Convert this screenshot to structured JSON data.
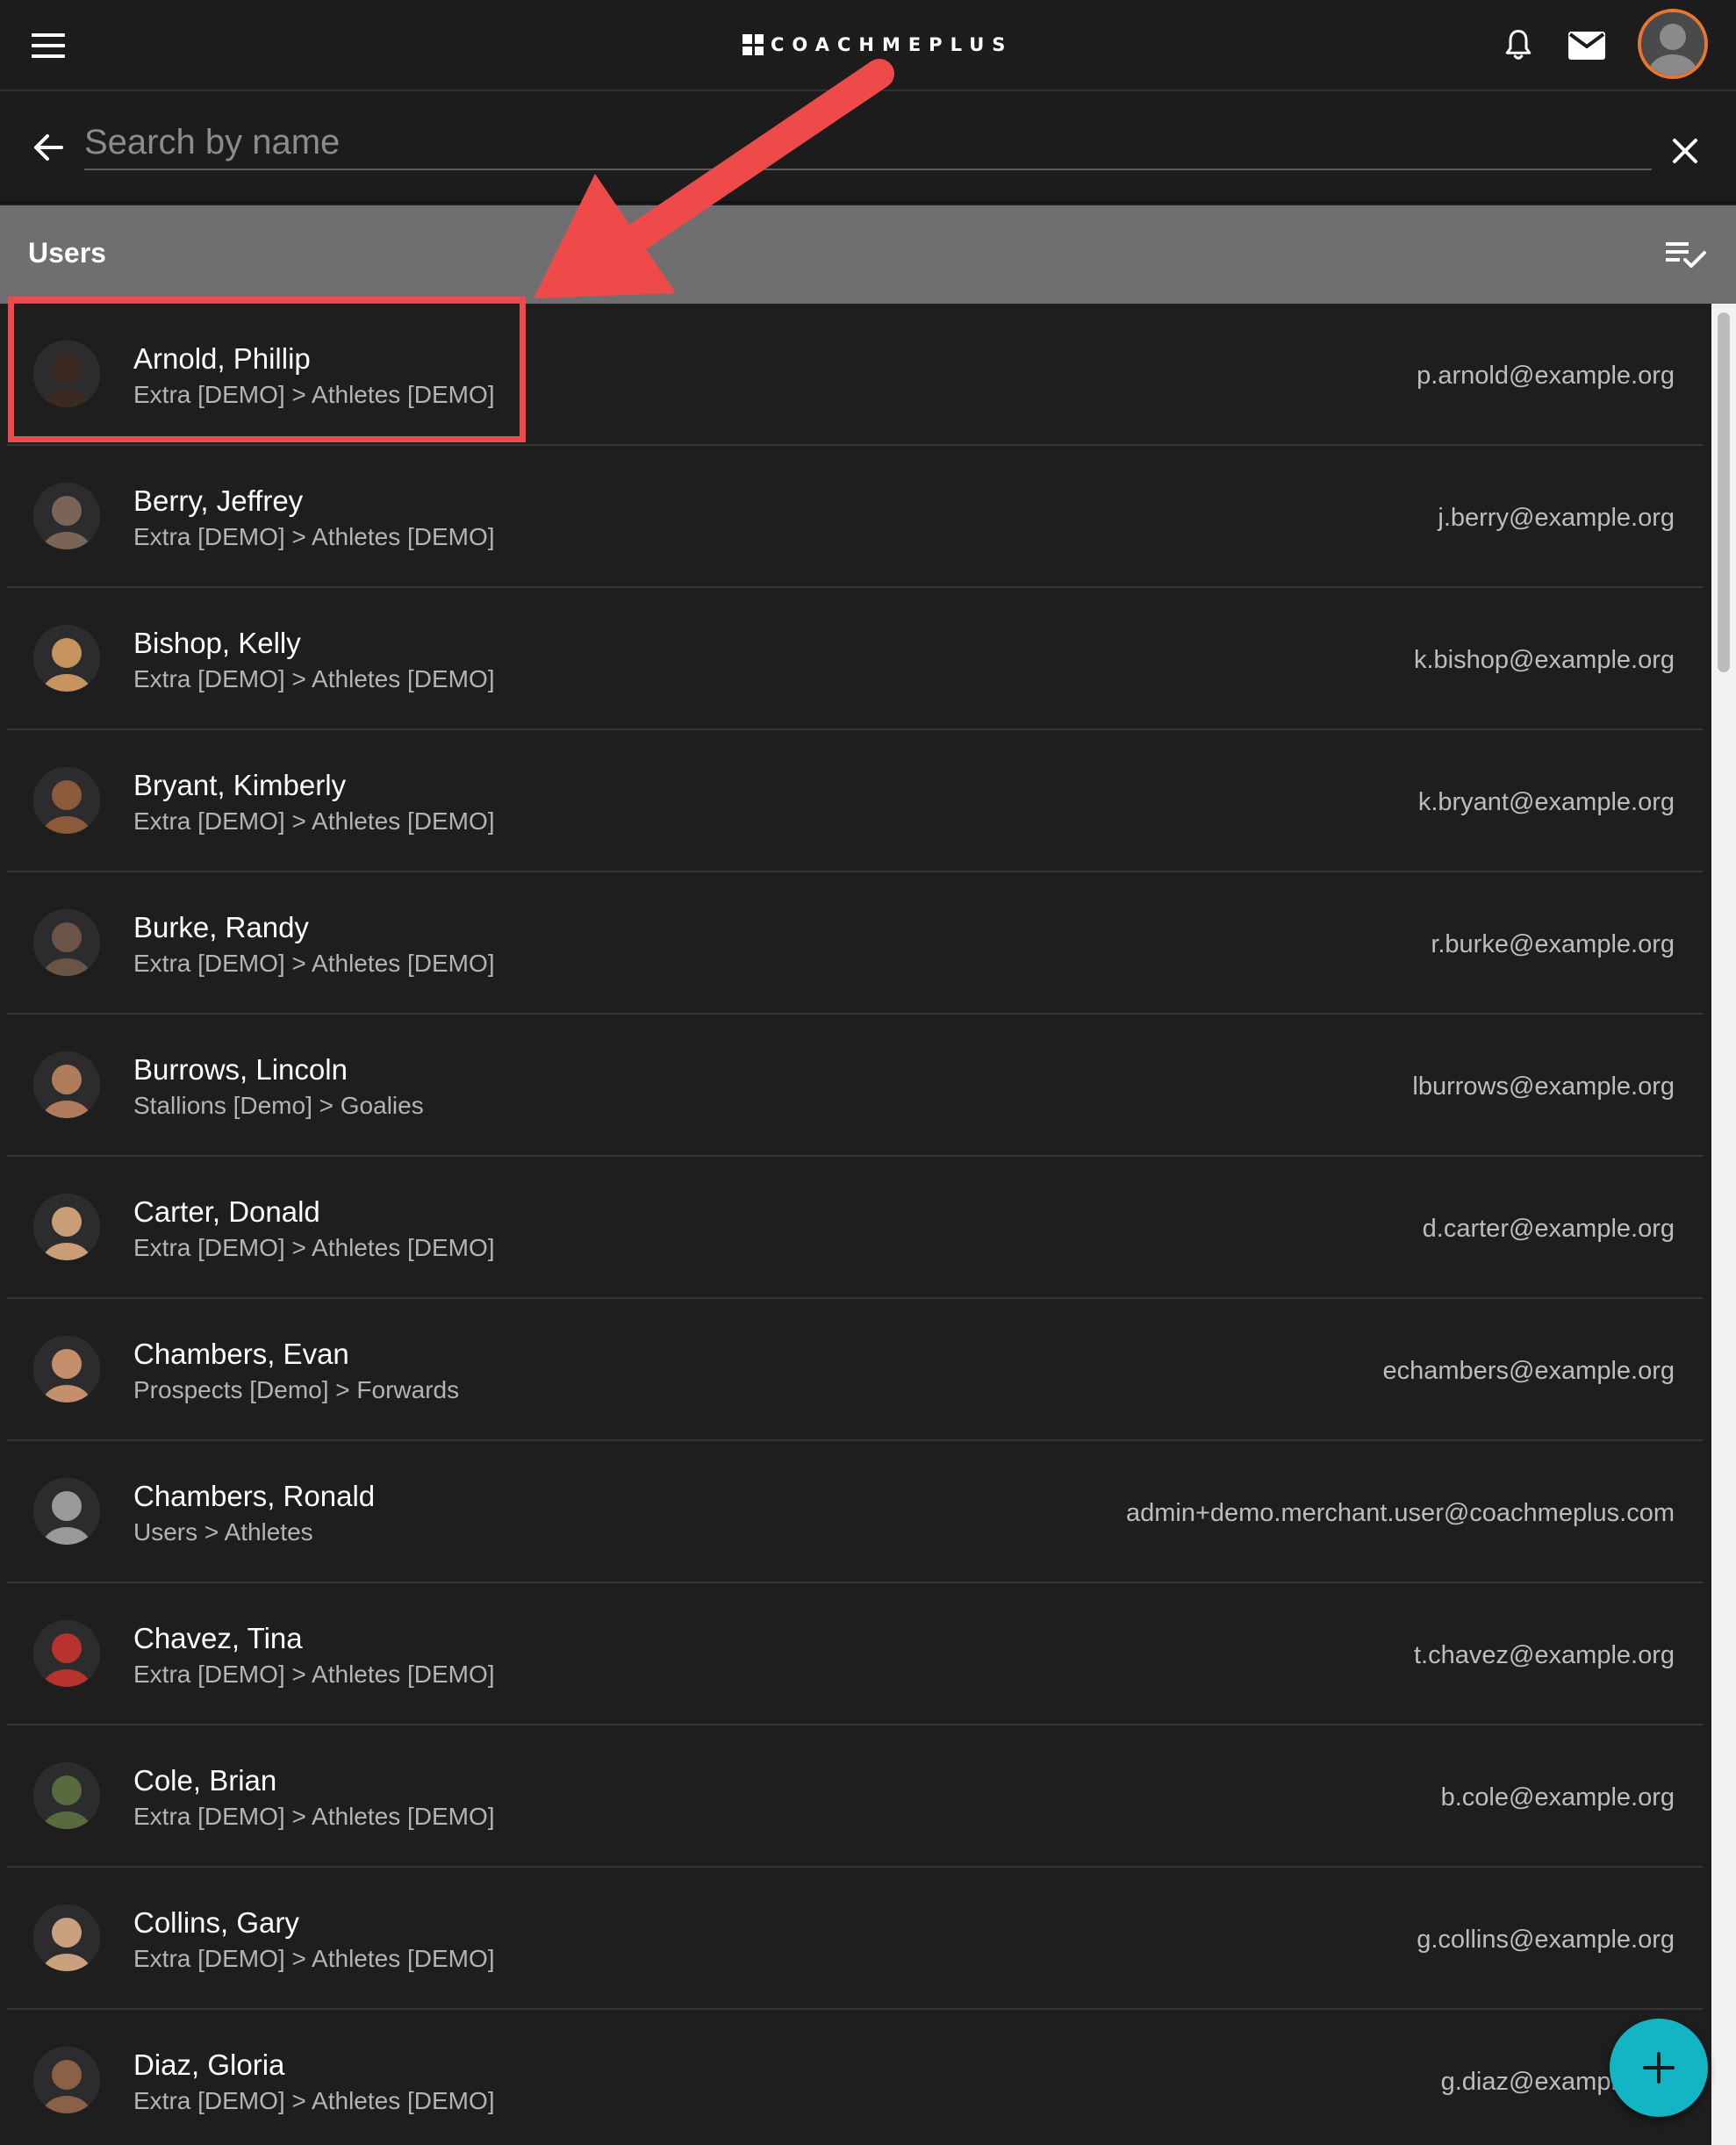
{
  "app": {
    "logo_text": "COACHMEPLUS"
  },
  "search": {
    "placeholder": "Search by name",
    "value": ""
  },
  "section": {
    "title": "Users"
  },
  "colors": {
    "accent": "#13b5c4",
    "avatar_ring": "#e8762f",
    "annotation": "#ee4a4a",
    "header_bg": "#6f6f72"
  },
  "icons": {
    "menu": "hamburger-icon",
    "notifications": "bell-icon",
    "messages": "mail-icon",
    "back": "arrow-left-icon",
    "clear": "close-icon",
    "sort": "playlist-check-icon",
    "add": "plus-icon"
  },
  "users": [
    {
      "name": "Arnold, Phillip",
      "group": "Extra [DEMO] > Athletes [DEMO]",
      "email": "p.arnold@example.org",
      "avatar_color": "#3b2a22"
    },
    {
      "name": "Berry, Jeffrey",
      "group": "Extra [DEMO] > Athletes [DEMO]",
      "email": "j.berry@example.org",
      "avatar_color": "#7a6456"
    },
    {
      "name": "Bishop, Kelly",
      "group": "Extra [DEMO] > Athletes [DEMO]",
      "email": "k.bishop@example.org",
      "avatar_color": "#c7935f"
    },
    {
      "name": "Bryant, Kimberly",
      "group": "Extra [DEMO] > Athletes [DEMO]",
      "email": "k.bryant@example.org",
      "avatar_color": "#8a5a3a"
    },
    {
      "name": "Burke, Randy",
      "group": "Extra [DEMO] > Athletes [DEMO]",
      "email": "r.burke@example.org",
      "avatar_color": "#6b5446"
    },
    {
      "name": "Burrows, Lincoln",
      "group": "Stallions [Demo] > Goalies",
      "email": "lburrows@example.org",
      "avatar_color": "#b07c5c"
    },
    {
      "name": "Carter, Donald",
      "group": "Extra [DEMO] > Athletes [DEMO]",
      "email": "d.carter@example.org",
      "avatar_color": "#c99d77"
    },
    {
      "name": "Chambers, Evan",
      "group": "Prospects [Demo] > Forwards",
      "email": "echambers@example.org",
      "avatar_color": "#c48f6a"
    },
    {
      "name": "Chambers, Ronald",
      "group": "Users > Athletes",
      "email": "admin+demo.merchant.user@coachmeplus.com",
      "avatar_color": "#9a9a9c"
    },
    {
      "name": "Chavez, Tina",
      "group": "Extra [DEMO] > Athletes [DEMO]",
      "email": "t.chavez@example.org",
      "avatar_color": "#b8322d"
    },
    {
      "name": "Cole, Brian",
      "group": "Extra [DEMO] > Athletes [DEMO]",
      "email": "b.cole@example.org",
      "avatar_color": "#5a6a3f"
    },
    {
      "name": "Collins, Gary",
      "group": "Extra [DEMO] > Athletes [DEMO]",
      "email": "g.collins@example.org",
      "avatar_color": "#c9a07e"
    },
    {
      "name": "Diaz, Gloria",
      "group": "Extra [DEMO] > Athletes [DEMO]",
      "email": "g.diaz@example.org",
      "avatar_color": "#8a6147"
    }
  ]
}
